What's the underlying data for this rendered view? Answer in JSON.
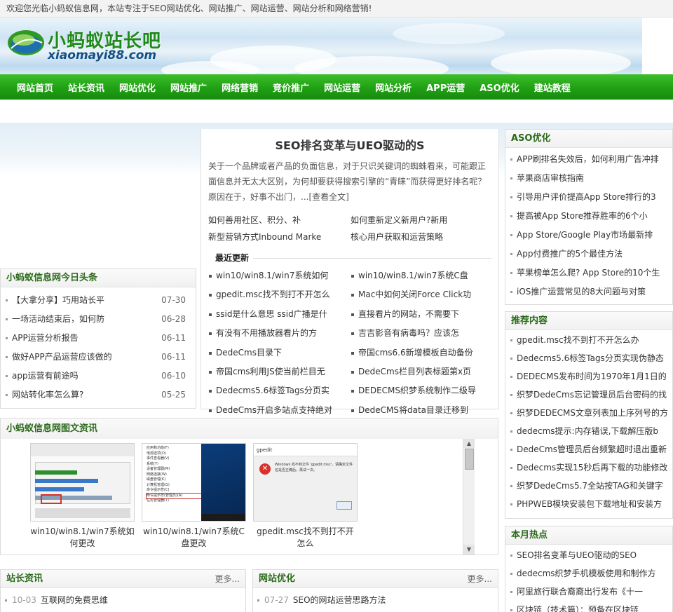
{
  "topbar": {
    "welcome": "欢迎您光临小蚂蚁信息网，本站专注于SEO网站优化、网站推广、网站运营、网站分析和网络营销!"
  },
  "logo": {
    "cn": "小蚂蚁站长吧",
    "en": "xiaomayi88.com"
  },
  "nav": [
    "网站首页",
    "站长资讯",
    "网站优化",
    "网站推广",
    "网络营销",
    "竞价推广",
    "网站运营",
    "网站分析",
    "APP运营",
    "ASO优化",
    "建站教程"
  ],
  "toutiao": {
    "title": "小蚂蚁信息网今日头条",
    "items": [
      {
        "text": "【大拿分享】巧用站长平",
        "date": "07-30"
      },
      {
        "text": "一场活动结束后，如何防",
        "date": "06-28"
      },
      {
        "text": "APP运营分析报告",
        "date": "06-11"
      },
      {
        "text": "做好APP产品运营应该做的",
        "date": "06-11"
      },
      {
        "text": "app运营有前途吗",
        "date": "06-10"
      },
      {
        "text": "网站转化率怎么算?",
        "date": "05-25"
      }
    ]
  },
  "center": {
    "headline": "SEO排名变革与UEO驱动的S",
    "summary": "关于一个品牌或者产品的负面信息，对于只识关键词的蜘蛛看来，可能跟正面信息并无太大区别，为何却要获得搜索引擎的“青睐”而获得更好排名呢？原因在于，好事不出门，...",
    "read_more": "[查看全文]",
    "links": [
      "如何善用社区、积分、补",
      "如何重新定义新用户?新用",
      "新型营销方式Inbound Marke",
      "核心用户获取和运营策略"
    ],
    "recent_title": "最近更新",
    "recent": [
      "win10/win8.1/win7系统如何",
      "win10/win8.1/win7系统C盘",
      "gpedit.msc找不到打不开怎么",
      "Mac中如何关闭Force Click功",
      "ssid是什么意思 ssid广播是什",
      "直接看片的网站，不需要下",
      "有没有不用播放器看片的方",
      "吉吉影音有病毒吗？应该怎",
      "DedeCms目录下",
      "帝国cms6.6新增模板自动备份",
      "帝国cms利用JS使当前栏目无",
      "DedeCms栏目列表标题第x页",
      "Dedecms5.6标签Tags分页实",
      "DEDECMS织梦系统制作二级导",
      "DedeCms开启多站点支持绝对",
      "DedeCMS将data目录迁移到"
    ]
  },
  "tuwen": {
    "title": "小蚂蚁信息网图文资讯",
    "items": [
      {
        "caption": "win10/win8.1/win7系统如何更改"
      },
      {
        "caption": "win10/win8.1/win7系统C盘更改"
      },
      {
        "caption": "gpedit.msc找不到打不开怎么"
      }
    ],
    "menu_lines": [
      "应用和功能(F)",
      "电源选项(O)",
      "事件查看器(V)",
      "系统(Y)",
      "设备管理器(M)",
      "网络连接(W)",
      "磁盘管理(K)",
      "计算机管理(G)",
      "命令提示符(C)",
      "命令提示符(管理员)(A)",
      "任务管理器(T)"
    ],
    "dialog_title": "gpedit",
    "dialog_msg": "Windows 找不到文件 'gpedit.msc'。请确定文件名是否正确后，再试一次。"
  },
  "aso": {
    "title": "ASO优化",
    "items": [
      "APP刷排名失效后，如何利用广告冲排",
      "苹果商店审核指南",
      "引导用户评价提高App Store排行的3",
      "提高被App Store推荐胜率的6个小",
      "App Store/Google Play市场最新排",
      "App付费推广的5个最佳方法",
      "苹果榜单怎么爬? App Store的10个生",
      "iOS推广运营常见的8大问题与对策"
    ]
  },
  "tuijian": {
    "title": "推荐内容",
    "items": [
      "gpedit.msc找不到打不开怎么办",
      "Dedecms5.6标签Tags分页实现伪静态",
      "DEDECMS发布时间为1970年1月1日的",
      "织梦DedeCms忘记管理员后台密码的找",
      "织梦DEDECMS文章列表加上序列号的方",
      "dedecms提示:内存错误,下载解压版b",
      "DedeCms管理员后台频繁超时退出重新",
      "Dedecms实现15秒后再下载的功能修改",
      "织梦DedeCms5.7全站按TAG和关键字",
      "PHPWEB模块安装包下载地址和安装方"
    ]
  },
  "redian": {
    "title": "本月热点",
    "items": [
      "SEO排名变革与UEO驱动的SEO",
      "dedecms织梦手机模板使用和制作方",
      "阿里旅行联合裔裔出行发布《十一",
      "区块链（技术篇）：预备在区块链"
    ]
  },
  "zhanzhang": {
    "title": "站长资讯",
    "more": "更多...",
    "items": [
      {
        "date": "10-03",
        "text": "互联网的免费思维"
      }
    ]
  },
  "youhua": {
    "title": "网站优化",
    "more": "更多...",
    "items": [
      {
        "date": "07-27",
        "text": "SEO的网站运营思路方法"
      }
    ]
  }
}
